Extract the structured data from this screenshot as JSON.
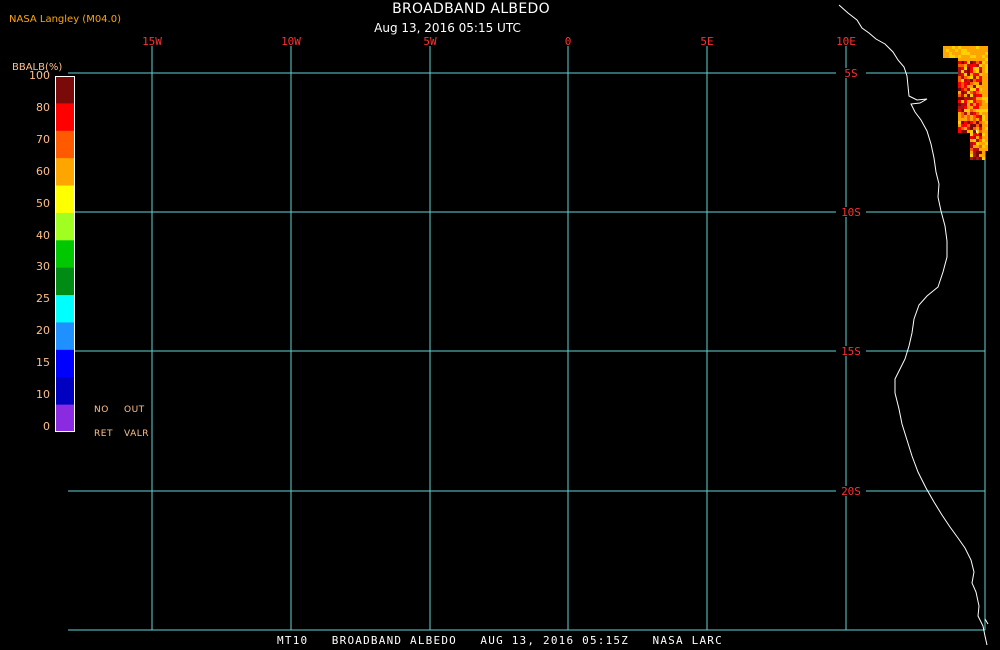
{
  "credit": "NASA Langley (M04.0)",
  "title": "BROADBAND ALBEDO",
  "subtitle": "Aug 13, 2016 05:15 UTC",
  "footer": "MT10   BROADBAND ALBEDO   AUG 13, 2016 05:15Z   NASA LARC",
  "colorbar": {
    "title": "BBALB(%)",
    "ticks": [
      "100",
      "80",
      "70",
      "60",
      "50",
      "40",
      "30",
      "25",
      "20",
      "15",
      "10",
      "0"
    ],
    "colors": [
      "#7a0a0a",
      "#ff0000",
      "#ff5a00",
      "#ffa500",
      "#ffff00",
      "#a0ff20",
      "#00c800",
      "#008c14",
      "#00ffff",
      "#1e90ff",
      "#0000ff",
      "#0000c0",
      "#8a2be2"
    ],
    "no_retrieval": [
      "NO",
      "RET"
    ],
    "out_of_range": [
      "OUT",
      "VALR"
    ]
  },
  "map": {
    "lon_labels": [
      "15W",
      "10W",
      "5W",
      "0",
      "5E",
      "10E"
    ],
    "lat_labels": [
      "5S",
      "10S",
      "15S",
      "20S"
    ],
    "grid_color": "#5fd3d3",
    "lon_label_color": "#ff3030",
    "lat_label_color": "#ff3030",
    "coast_color": "#ffffff",
    "retrieval_colors": [
      "#ffa500",
      "#ff5a00",
      "#ff0000",
      "#b01010",
      "#7a0a0a",
      "#ffd000"
    ]
  }
}
